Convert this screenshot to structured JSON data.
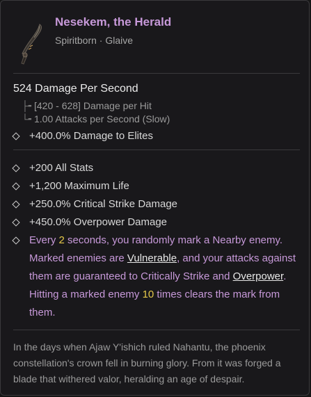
{
  "item": {
    "name": "Nesekem, the Herald",
    "type": "Spiritborn · Glaive",
    "icon": "glaive-icon"
  },
  "weapon_stats": {
    "dps": "524 Damage Per Second",
    "damage_per_hit": "[420 - 628] Damage per Hit",
    "attack_speed": "1.00 Attacks per Second (Slow)",
    "implicit": "+400.0% Damage to Elites"
  },
  "affixes": [
    "+200 All Stats",
    "+1,200 Maximum Life",
    "+250.0% Critical Strike Damage",
    "+450.0% Overpower Damage"
  ],
  "legendary_power": {
    "t1": "Every ",
    "n1": "2",
    "t2": " seconds, you randomly mark a Nearby enemy. Marked enemies are ",
    "kw1": "Vulnerable",
    "t3": ", and your attacks against them are guaranteed to Critically Strike and ",
    "kw2": "Overpower",
    "t4": ". Hitting a marked enemy ",
    "n2": "10",
    "t5": " times clears the mark from them."
  },
  "flavor_text": "In the days when Ajaw Y'ishich ruled Nahantu, the phoenix constellation's crown fell in burning glory. From it was forged a blade that withered valor, heralding an age of despair.",
  "colors": {
    "unique_name": "#c799d9",
    "number_highlight": "#e6c84a",
    "background": "#19181b"
  }
}
